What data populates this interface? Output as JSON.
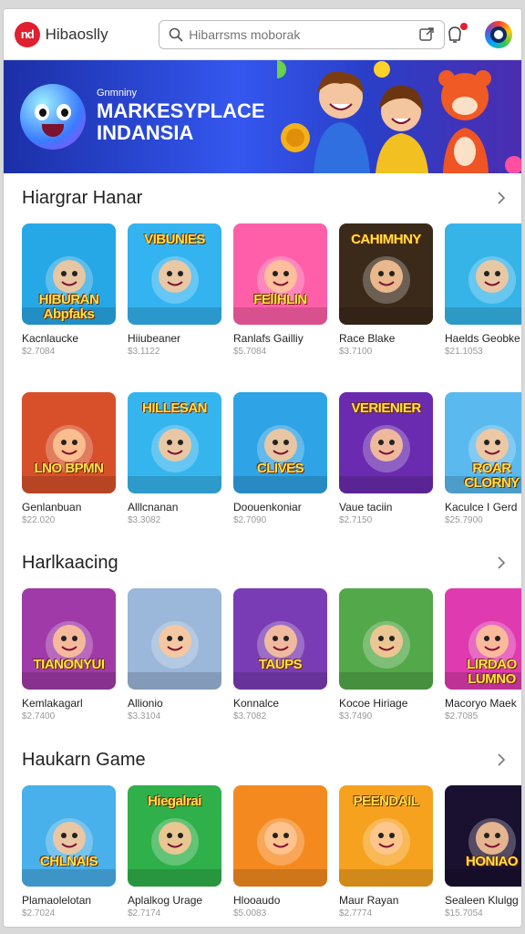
{
  "header": {
    "logo_badge": "nd",
    "logo_text": "Hibaoslly",
    "search_placeholder": "Hibarrsms moborak",
    "icons": [
      "search-icon",
      "external-link-icon",
      "notification-icon",
      "profile-avatar"
    ],
    "notification_color": "#e0202f"
  },
  "banner": {
    "kicker": "Gnmniny",
    "title": "MARKESYPLACE INDANSIA"
  },
  "sections": [
    {
      "title": "Hiargrar Hanar",
      "items": [
        {
          "name": "Kacnlaucke",
          "price": "$2.7084",
          "art": "HIBURAN Abpfaks",
          "bg": "#27a8e6"
        },
        {
          "name": "Hiiubeaner",
          "price": "$3.1122",
          "art": "VIBUNIES",
          "bg": "#33b3f0"
        },
        {
          "name": "Ranlafs Gailliy",
          "price": "$5.7084",
          "art": "FEllHLIN",
          "bg": "#ff5fa8"
        },
        {
          "name": "Race Blake",
          "price": "$3.7100",
          "art": "CAHIMHNY",
          "bg": "#3b2a1a"
        },
        {
          "name": "Haelds Geobke",
          "price": "$21.1053",
          "art": "",
          "bg": "#36b4e8"
        }
      ]
    },
    {
      "title": "",
      "items": [
        {
          "name": "Genlanbuan",
          "price": "$22.020",
          "art": "LNO BPMN",
          "bg": "#d8502a"
        },
        {
          "name": "Alllcnanan",
          "price": "$3.3082",
          "art": "HILLESAN",
          "bg": "#35b5ee"
        },
        {
          "name": "Doouenkoniar",
          "price": "$2.7090",
          "art": "CLIVES",
          "bg": "#2ea3e6"
        },
        {
          "name": "Vaue taciin",
          "price": "$2.7150",
          "art": "VERIENIER",
          "bg": "#6a2bb0"
        },
        {
          "name": "Kaculce I Gerd",
          "price": "$25.7900",
          "art": "ROAR CLORNY",
          "bg": "#5ab9ee"
        }
      ]
    },
    {
      "title": "Harlkaacing",
      "items": [
        {
          "name": "Kemlakagarl",
          "price": "$2.7400",
          "art": "TIANONYUI",
          "bg": "#a03aa8"
        },
        {
          "name": "Allionio",
          "price": "$3.3104",
          "art": "",
          "bg": "#9bb7d9"
        },
        {
          "name": "Konnalce",
          "price": "$3.7082",
          "art": "TAUPS",
          "bg": "#7a3cb5"
        },
        {
          "name": "Kocoe Hiriage",
          "price": "$3.7490",
          "art": "",
          "bg": "#53a84a"
        },
        {
          "name": "Macoryo Maek",
          "price": "$2.7085",
          "art": "LIRDAO LUMNO",
          "bg": "#e03ab0"
        }
      ]
    },
    {
      "title": "Haukarn Game",
      "items": [
        {
          "name": "Plamaolelotan",
          "price": "$2.7024",
          "art": "CHLNAIS",
          "bg": "#48b0ea"
        },
        {
          "name": "Aplalkog Urage",
          "price": "$2.7174",
          "art": "Hiegalrai",
          "bg": "#2fb04a"
        },
        {
          "name": "Hlooaudo",
          "price": "$5.0083",
          "art": "",
          "bg": "#f48a1f"
        },
        {
          "name": "Maur Rayan",
          "price": "$2.7774",
          "art": "PEENDAIL",
          "bg": "#f6a21e"
        },
        {
          "name": "Sealeen Klulgg",
          "price": "$15.7054",
          "art": "HONIAO",
          "bg": "#1a1030"
        }
      ]
    }
  ]
}
